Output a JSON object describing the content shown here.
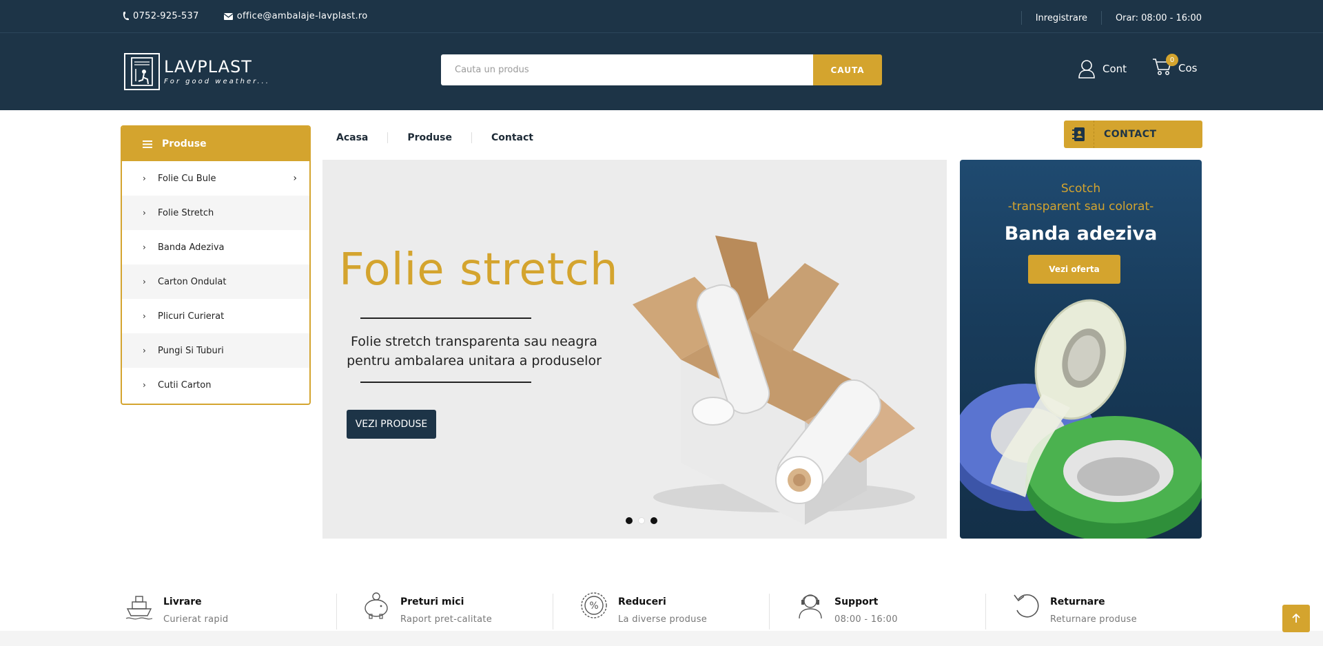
{
  "topbar": {
    "phone": "0752-925-537",
    "email": "office@ambalaje-lavplast.ro",
    "register": "Inregistrare",
    "hours": "Orar: 08:00 - 16:00"
  },
  "header": {
    "logo_name": "LAVPLAST",
    "logo_tagline": "For good weather...",
    "search_placeholder": "Cauta un produs",
    "search_button": "CAUTA",
    "account_label": "Cont",
    "cart_label": "Cos",
    "cart_count": "0"
  },
  "sidebar": {
    "title": "Produse",
    "items": [
      {
        "label": "Folie Cu Bule"
      },
      {
        "label": "Folie Stretch"
      },
      {
        "label": "Banda Adeziva"
      },
      {
        "label": "Carton Ondulat"
      },
      {
        "label": "Plicuri Curierat"
      },
      {
        "label": "Pungi Si Tuburi"
      },
      {
        "label": "Cutii Carton"
      }
    ]
  },
  "nav": {
    "links": [
      "Acasa",
      "Produse",
      "Contact"
    ],
    "contact_button": "CONTACT"
  },
  "slider": {
    "heading": "Folie stretch",
    "sub_line1": "Folie stretch transparenta sau neagra",
    "sub_line2": "pentru ambalarea unitara a produselor",
    "cta": "VEZI PRODUSE",
    "slide_count": 3,
    "active_slide": 2
  },
  "banner": {
    "line1": "Scotch",
    "line2": "-transparent sau colorat-",
    "title": "Banda adeziva",
    "button": "Vezi oferta"
  },
  "features": [
    {
      "title": "Livrare",
      "subtitle": "Curierat rapid",
      "icon": "ship-icon"
    },
    {
      "title": "Preturi mici",
      "subtitle": "Raport pret-calitate",
      "icon": "piggy-bank-icon"
    },
    {
      "title": "Reduceri",
      "subtitle": "La diverse produse",
      "icon": "percent-badge-icon"
    },
    {
      "title": "Support",
      "subtitle": "08:00 - 16:00",
      "icon": "support-agent-icon"
    },
    {
      "title": "Returnare",
      "subtitle": "Returnare produse",
      "icon": "undo-arrow-icon"
    }
  ],
  "colors": {
    "navy": "#1d3447",
    "gold": "#d4a42e"
  }
}
